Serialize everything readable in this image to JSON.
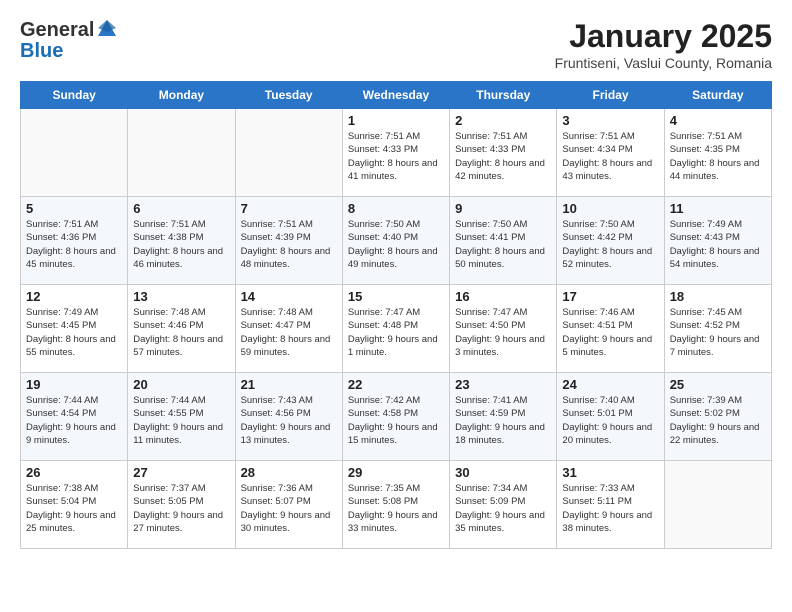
{
  "logo": {
    "general": "General",
    "blue": "Blue"
  },
  "header": {
    "title": "January 2025",
    "subtitle": "Fruntiseni, Vaslui County, Romania"
  },
  "weekdays": [
    "Sunday",
    "Monday",
    "Tuesday",
    "Wednesday",
    "Thursday",
    "Friday",
    "Saturday"
  ],
  "weeks": [
    [
      {
        "day": "",
        "info": ""
      },
      {
        "day": "",
        "info": ""
      },
      {
        "day": "",
        "info": ""
      },
      {
        "day": "1",
        "info": "Sunrise: 7:51 AM\nSunset: 4:33 PM\nDaylight: 8 hours and 41 minutes."
      },
      {
        "day": "2",
        "info": "Sunrise: 7:51 AM\nSunset: 4:33 PM\nDaylight: 8 hours and 42 minutes."
      },
      {
        "day": "3",
        "info": "Sunrise: 7:51 AM\nSunset: 4:34 PM\nDaylight: 8 hours and 43 minutes."
      },
      {
        "day": "4",
        "info": "Sunrise: 7:51 AM\nSunset: 4:35 PM\nDaylight: 8 hours and 44 minutes."
      }
    ],
    [
      {
        "day": "5",
        "info": "Sunrise: 7:51 AM\nSunset: 4:36 PM\nDaylight: 8 hours and 45 minutes."
      },
      {
        "day": "6",
        "info": "Sunrise: 7:51 AM\nSunset: 4:38 PM\nDaylight: 8 hours and 46 minutes."
      },
      {
        "day": "7",
        "info": "Sunrise: 7:51 AM\nSunset: 4:39 PM\nDaylight: 8 hours and 48 minutes."
      },
      {
        "day": "8",
        "info": "Sunrise: 7:50 AM\nSunset: 4:40 PM\nDaylight: 8 hours and 49 minutes."
      },
      {
        "day": "9",
        "info": "Sunrise: 7:50 AM\nSunset: 4:41 PM\nDaylight: 8 hours and 50 minutes."
      },
      {
        "day": "10",
        "info": "Sunrise: 7:50 AM\nSunset: 4:42 PM\nDaylight: 8 hours and 52 minutes."
      },
      {
        "day": "11",
        "info": "Sunrise: 7:49 AM\nSunset: 4:43 PM\nDaylight: 8 hours and 54 minutes."
      }
    ],
    [
      {
        "day": "12",
        "info": "Sunrise: 7:49 AM\nSunset: 4:45 PM\nDaylight: 8 hours and 55 minutes."
      },
      {
        "day": "13",
        "info": "Sunrise: 7:48 AM\nSunset: 4:46 PM\nDaylight: 8 hours and 57 minutes."
      },
      {
        "day": "14",
        "info": "Sunrise: 7:48 AM\nSunset: 4:47 PM\nDaylight: 8 hours and 59 minutes."
      },
      {
        "day": "15",
        "info": "Sunrise: 7:47 AM\nSunset: 4:48 PM\nDaylight: 9 hours and 1 minute."
      },
      {
        "day": "16",
        "info": "Sunrise: 7:47 AM\nSunset: 4:50 PM\nDaylight: 9 hours and 3 minutes."
      },
      {
        "day": "17",
        "info": "Sunrise: 7:46 AM\nSunset: 4:51 PM\nDaylight: 9 hours and 5 minutes."
      },
      {
        "day": "18",
        "info": "Sunrise: 7:45 AM\nSunset: 4:52 PM\nDaylight: 9 hours and 7 minutes."
      }
    ],
    [
      {
        "day": "19",
        "info": "Sunrise: 7:44 AM\nSunset: 4:54 PM\nDaylight: 9 hours and 9 minutes."
      },
      {
        "day": "20",
        "info": "Sunrise: 7:44 AM\nSunset: 4:55 PM\nDaylight: 9 hours and 11 minutes."
      },
      {
        "day": "21",
        "info": "Sunrise: 7:43 AM\nSunset: 4:56 PM\nDaylight: 9 hours and 13 minutes."
      },
      {
        "day": "22",
        "info": "Sunrise: 7:42 AM\nSunset: 4:58 PM\nDaylight: 9 hours and 15 minutes."
      },
      {
        "day": "23",
        "info": "Sunrise: 7:41 AM\nSunset: 4:59 PM\nDaylight: 9 hours and 18 minutes."
      },
      {
        "day": "24",
        "info": "Sunrise: 7:40 AM\nSunset: 5:01 PM\nDaylight: 9 hours and 20 minutes."
      },
      {
        "day": "25",
        "info": "Sunrise: 7:39 AM\nSunset: 5:02 PM\nDaylight: 9 hours and 22 minutes."
      }
    ],
    [
      {
        "day": "26",
        "info": "Sunrise: 7:38 AM\nSunset: 5:04 PM\nDaylight: 9 hours and 25 minutes."
      },
      {
        "day": "27",
        "info": "Sunrise: 7:37 AM\nSunset: 5:05 PM\nDaylight: 9 hours and 27 minutes."
      },
      {
        "day": "28",
        "info": "Sunrise: 7:36 AM\nSunset: 5:07 PM\nDaylight: 9 hours and 30 minutes."
      },
      {
        "day": "29",
        "info": "Sunrise: 7:35 AM\nSunset: 5:08 PM\nDaylight: 9 hours and 33 minutes."
      },
      {
        "day": "30",
        "info": "Sunrise: 7:34 AM\nSunset: 5:09 PM\nDaylight: 9 hours and 35 minutes."
      },
      {
        "day": "31",
        "info": "Sunrise: 7:33 AM\nSunset: 5:11 PM\nDaylight: 9 hours and 38 minutes."
      },
      {
        "day": "",
        "info": ""
      }
    ]
  ]
}
